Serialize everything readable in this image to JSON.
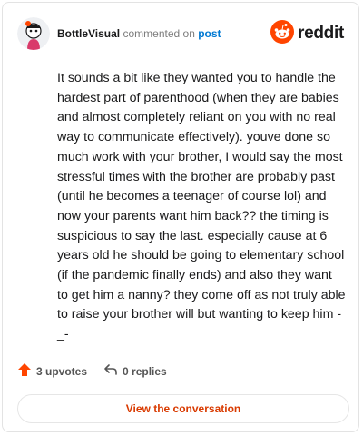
{
  "header": {
    "username": "BottleVisual",
    "action_text": "commented on",
    "target_link": "post",
    "brand_word": "reddit",
    "avatar_icon": "user-avatar-icon",
    "logo_icon": "reddit-snoo-icon"
  },
  "comment": {
    "body": "It sounds a bit like they wanted you to handle the hardest part of parenthood (when they are babies and almost completely reliant on you with no real way to communicate effectively). youve done so much work with your brother, I would say the most stressful times with the brother are probably past (until he becomes a teenager of course lol) and now your parents want him back?? the timing is suspicious to say the last. especially cause at 6 years old he should be going to elementary school (if the pandemic finally ends) and also they want to get him a nanny? they come off as not truly able to raise your brother will but wanting to keep him -_-"
  },
  "actions": {
    "upvotes_label": "3 upvotes",
    "replies_label": "0 replies",
    "upvote_icon": "upvote-arrow-icon",
    "reply_icon": "reply-icon"
  },
  "cta": {
    "label": "View the conversation"
  },
  "colors": {
    "brand": "#ff4500",
    "link": "#0079d3",
    "cta_text": "#d93a00"
  }
}
